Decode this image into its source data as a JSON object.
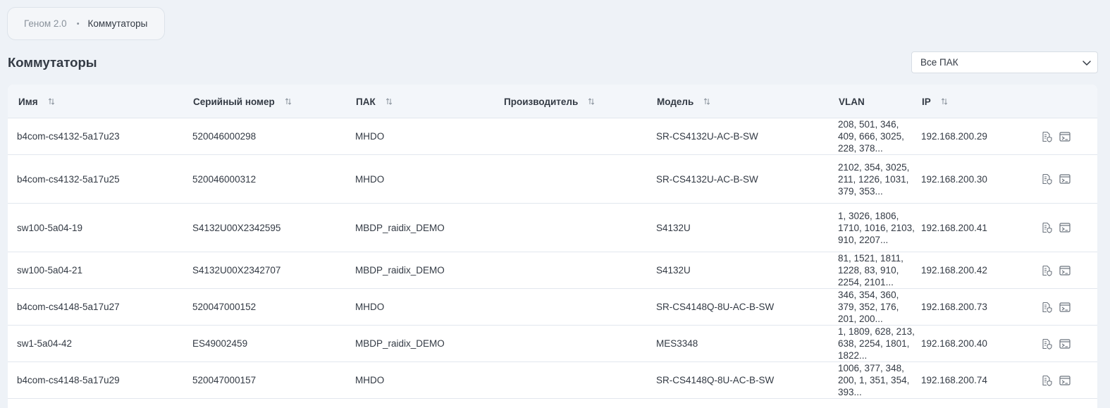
{
  "breadcrumb": {
    "root": "Геном 2.0",
    "separator": "•",
    "current": "Коммутаторы"
  },
  "page_title": "Коммутаторы",
  "filter": {
    "selected": "Все ПАК"
  },
  "table": {
    "columns": [
      {
        "key": "name",
        "label": "Имя",
        "sortable": true
      },
      {
        "key": "serial",
        "label": "Серийный номер",
        "sortable": true
      },
      {
        "key": "pak",
        "label": "ПАК",
        "sortable": true
      },
      {
        "key": "vendor",
        "label": "Производитель",
        "sortable": true
      },
      {
        "key": "model",
        "label": "Модель",
        "sortable": true
      },
      {
        "key": "vlan",
        "label": "VLAN",
        "sortable": false
      },
      {
        "key": "ip",
        "label": "IP",
        "sortable": true
      }
    ],
    "rows": [
      {
        "name": "b4com-cs4132-5a17u23",
        "serial": "520046000298",
        "pak": "MHDO",
        "vendor": "",
        "model": "SR-CS4132U-AC-B-SW",
        "vlan": "208, 501, 346, 409, 666, 3025, 228, 378...",
        "ip": "192.168.200.29"
      },
      {
        "name": "b4com-cs4132-5a17u25",
        "serial": "520046000312",
        "pak": "MHDO",
        "vendor": "",
        "model": "SR-CS4132U-AC-B-SW",
        "vlan": "2102, 354, 3025, 211, 1226, 1031, 379, 353...",
        "ip": "192.168.200.30"
      },
      {
        "name": "sw100-5a04-19",
        "serial": "S4132U00X2342595",
        "pak": "MBDP_raidix_DEMO",
        "vendor": "",
        "model": "S4132U",
        "vlan": "1, 3026, 1806, 1710, 1016, 2103, 910, 2207...",
        "ip": "192.168.200.41"
      },
      {
        "name": "sw100-5a04-21",
        "serial": "S4132U00X2342707",
        "pak": "MBDP_raidix_DEMO",
        "vendor": "",
        "model": "S4132U",
        "vlan": "81, 1521, 1811, 1228, 83, 910, 2254, 2101...",
        "ip": "192.168.200.42"
      },
      {
        "name": "b4com-cs4148-5a17u27",
        "serial": "520047000152",
        "pak": "MHDO",
        "vendor": "",
        "model": "SR-CS4148Q-8U-AC-B-SW",
        "vlan": "346, 354, 360, 379, 352, 176, 201, 200...",
        "ip": "192.168.200.73"
      },
      {
        "name": "sw1-5a04-42",
        "serial": "ES49002459",
        "pak": "MBDP_raidix_DEMO",
        "vendor": "",
        "model": "MES3348",
        "vlan": "1, 1809, 628, 213, 638, 2254, 1801, 1822...",
        "ip": "192.168.200.40"
      },
      {
        "name": "b4com-cs4148-5a17u29",
        "serial": "520047000157",
        "pak": "MHDO",
        "vendor": "",
        "model": "SR-CS4148Q-8U-AC-B-SW",
        "vlan": "1006, 377, 348, 200, 1, 351, 354, 393...",
        "ip": "192.168.200.74"
      }
    ],
    "row_actions": [
      "shield-document-icon",
      "console-icon"
    ]
  },
  "colors": {
    "background": "#eef2f7",
    "header_bg": "#f3f6fa",
    "text": "#333a44",
    "muted": "#8a929c",
    "icon": "#6b737d"
  }
}
